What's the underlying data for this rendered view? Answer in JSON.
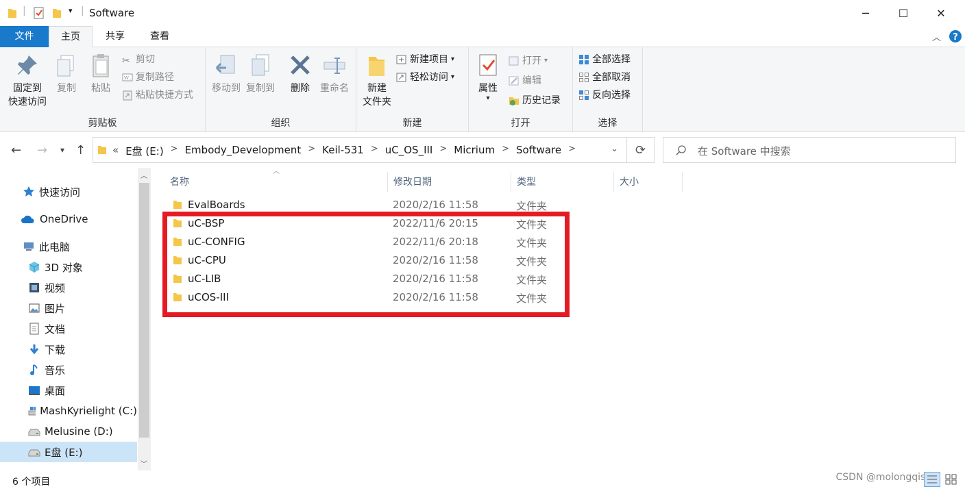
{
  "window": {
    "title": "Software",
    "minimize": "─",
    "maximize": "☐",
    "close": "✕"
  },
  "ribbon_tabs": [
    "文件",
    "主页",
    "共享",
    "查看"
  ],
  "ribbon": {
    "clipboard": {
      "label": "剪贴板",
      "pin": "固定到\n快速访问",
      "pin_line1": "固定到",
      "pin_line2": "快速访问",
      "copy": "复制",
      "paste": "粘贴",
      "cut": "剪切",
      "copy_path": "复制路径",
      "paste_shortcut": "粘贴快捷方式"
    },
    "organize": {
      "label": "组织",
      "move_to": "移动到",
      "copy_to": "复制到",
      "delete": "删除",
      "rename": "重命名"
    },
    "new": {
      "label": "新建",
      "new_folder_line1": "新建",
      "new_folder_line2": "文件夹",
      "new_item": "新建项目",
      "easy_access": "轻松访问"
    },
    "open": {
      "label": "打开",
      "properties": "属性",
      "open": "打开",
      "edit": "编辑",
      "history": "历史记录"
    },
    "select": {
      "label": "选择",
      "select_all": "全部选择",
      "select_none": "全部取消",
      "invert": "反向选择"
    }
  },
  "address": {
    "overflow": "«",
    "crumbs": [
      "E盘 (E:)",
      "Embody_Development",
      "Keil-531",
      "uC_OS_III",
      "Micrium",
      "Software"
    ],
    "search_placeholder": "在 Software 中搜索"
  },
  "sidebar": {
    "items": [
      {
        "label": "快速访问",
        "icon": "star-icon"
      },
      {
        "label": "OneDrive",
        "icon": "cloud-icon"
      },
      {
        "label": "此电脑",
        "icon": "computer-icon"
      },
      {
        "label": "3D 对象",
        "icon": "cube-icon"
      },
      {
        "label": "视频",
        "icon": "film-icon"
      },
      {
        "label": "图片",
        "icon": "picture-icon"
      },
      {
        "label": "文档",
        "icon": "document-icon"
      },
      {
        "label": "下载",
        "icon": "download-icon"
      },
      {
        "label": "音乐",
        "icon": "music-icon"
      },
      {
        "label": "桌面",
        "icon": "desktop-icon"
      },
      {
        "label": "MashKyrielight (C:)",
        "icon": "drive-icon"
      },
      {
        "label": "Melusine (D:)",
        "icon": "drive-icon"
      },
      {
        "label": "E盘 (E:)",
        "icon": "drive-icon"
      }
    ]
  },
  "columns": {
    "name": "名称",
    "date": "修改日期",
    "type": "类型",
    "size": "大小"
  },
  "files": [
    {
      "name": "EvalBoards",
      "date": "2020/2/16 11:58",
      "type": "文件夹"
    },
    {
      "name": "uC-BSP",
      "date": "2022/11/6 20:15",
      "type": "文件夹"
    },
    {
      "name": "uC-CONFIG",
      "date": "2022/11/6 20:18",
      "type": "文件夹"
    },
    {
      "name": "uC-CPU",
      "date": "2020/2/16 11:58",
      "type": "文件夹"
    },
    {
      "name": "uC-LIB",
      "date": "2020/2/16 11:58",
      "type": "文件夹"
    },
    {
      "name": "uCOS-III",
      "date": "2020/2/16 11:58",
      "type": "文件夹"
    }
  ],
  "status": {
    "count": "6 个项目"
  },
  "watermark": "CSDN @molongqishui",
  "colors": {
    "accent": "#1979ca",
    "highlight": "#e51b24",
    "folder": "#f4c64a"
  }
}
